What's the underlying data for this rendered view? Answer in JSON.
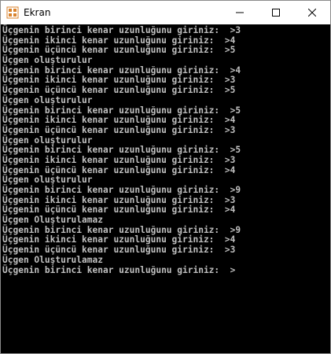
{
  "window": {
    "title": "Ekran",
    "icon": "console-app-icon",
    "controls": [
      "minimize",
      "maximize",
      "close"
    ]
  },
  "console": {
    "lines": [
      "Üçgenin birinci kenar uzunluğunu giriniz:  >3",
      "Üçgenin ikinci kenar uzunluğunu giriniz:  >4",
      "Üçgenin üçüncü kenar uzunluğunu giriniz:  >5",
      "Üçgen oluşturulur",
      "Üçgenin birinci kenar uzunluğunu giriniz:  >4",
      "Üçgenin ikinci kenar uzunluğunu giriniz:  >3",
      "Üçgenin üçüncü kenar uzunluğunu giriniz:  >5",
      "Üçgen oluşturulur",
      "Üçgenin birinci kenar uzunluğunu giriniz:  >5",
      "Üçgenin ikinci kenar uzunluğunu giriniz:  >4",
      "Üçgenin üçüncü kenar uzunluğunu giriniz:  >3",
      "Üçgen oluşturulur",
      "Üçgenin birinci kenar uzunluğunu giriniz:  >5",
      "Üçgenin ikinci kenar uzunluğunu giriniz:  >3",
      "Üçgenin üçüncü kenar uzunluğunu giriniz:  >4",
      "Üçgen oluşturulur",
      "Üçgenin birinci kenar uzunluğunu giriniz:  >9",
      "Üçgenin ikinci kenar uzunluğunu giriniz:  >3",
      "Üçgenin üçüncü kenar uzunluğunu giriniz:  >4",
      "Üçgen Oluşturulamaz",
      "Üçgenin birinci kenar uzunluğunu giriniz:  >9",
      "Üçgenin ikinci kenar uzunluğunu giriniz:  >4",
      "Üçgenin üçüncü kenar uzunluğunu giriniz:  >3",
      "Üçgen Oluşturulamaz",
      "Üçgenin birinci kenar uzunluğunu giriniz:  >"
    ]
  },
  "colors": {
    "console_background": "#000000",
    "console_text": "#c0c0c0",
    "titlebar_background": "#ffffff",
    "icon_accent": "#d9822b"
  }
}
